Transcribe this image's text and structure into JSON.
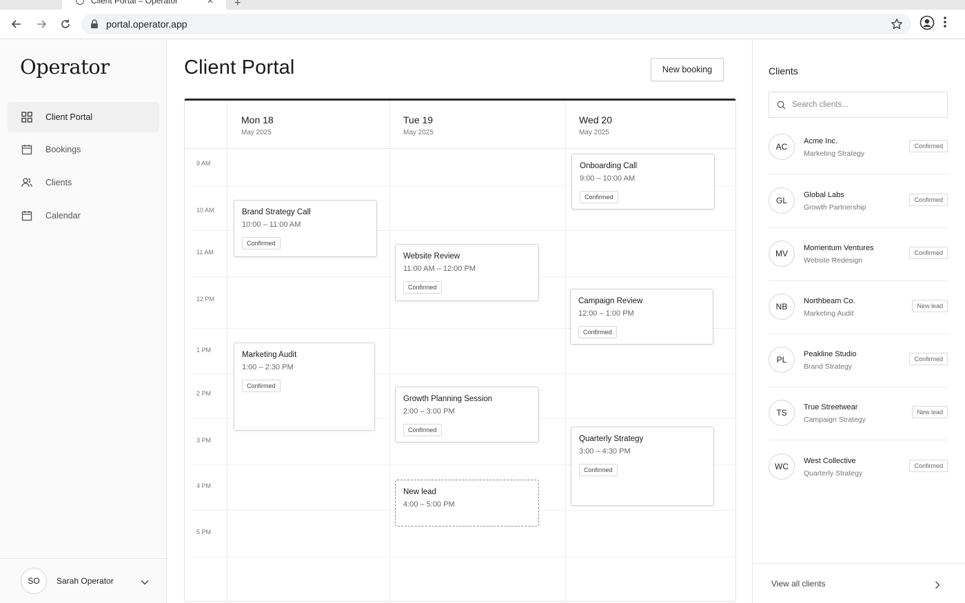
{
  "browser": {
    "tab_title": "Client Portal – Operator",
    "url": "portal.operator.app"
  },
  "sidebar": {
    "logo": "Operator",
    "items": [
      {
        "label": "Client Portal",
        "icon": "grid-icon",
        "active": true
      },
      {
        "label": "Bookings",
        "icon": "calendar-icon",
        "active": false
      },
      {
        "label": "Clients",
        "icon": "users-icon",
        "active": false
      },
      {
        "label": "Calendar",
        "icon": "calendar-icon",
        "active": false
      }
    ],
    "user": {
      "initials": "SO",
      "name": "Sarah Operator"
    }
  },
  "main": {
    "title": "Client Portal",
    "new_booking_label": "New booking",
    "days": [
      {
        "name": "Mon 18",
        "sub": "May 2025"
      },
      {
        "name": "Tue 19",
        "sub": "May 2025"
      },
      {
        "name": "Wed 20",
        "sub": "May 2025"
      }
    ],
    "time_labels": [
      "9 AM",
      "10 AM",
      "11 AM",
      "12 PM",
      "1 PM",
      "2 PM",
      "3 PM",
      "4 PM",
      "5 PM"
    ],
    "events": [
      {
        "day": 0,
        "title": "Brand Strategy Call",
        "time": "10:00 – 11:00 AM",
        "badge": "Confirmed",
        "dashed": false
      },
      {
        "day": 0,
        "title": "Marketing Audit",
        "time": "1:00 – 2:30 PM",
        "badge": "Confirmed",
        "dashed": false
      },
      {
        "day": 1,
        "title": "Website Review",
        "time": "11:00 AM – 12:00 PM",
        "badge": "Confirmed",
        "dashed": false
      },
      {
        "day": 1,
        "title": "Growth Planning Session",
        "time": "2:00 – 3:00 PM",
        "badge": "Confirmed",
        "dashed": false
      },
      {
        "day": 1,
        "title": "New lead",
        "time": "4:00 – 5:00 PM",
        "badge": "",
        "dashed": true
      },
      {
        "day": 2,
        "title": "Onboarding Call",
        "time": "9:00 – 10:00 AM",
        "badge": "Confirmed",
        "dashed": false
      },
      {
        "day": 2,
        "title": "Campaign Review",
        "time": "12:00 – 1:00 PM",
        "badge": "Confirmed",
        "dashed": false
      },
      {
        "day": 2,
        "title": "Quarterly Strategy",
        "time": "3:00 – 4:30 PM",
        "badge": "Confirmed",
        "dashed": false
      }
    ]
  },
  "clients_panel": {
    "title": "Clients",
    "search_placeholder": "Search clients...",
    "clients": [
      {
        "initials": "AC",
        "name": "Acme Inc.",
        "sub": "Marketing Strategy",
        "status": "Confirmed"
      },
      {
        "initials": "GL",
        "name": "Global Labs",
        "sub": "Growth Partnership",
        "status": "Confirmed"
      },
      {
        "initials": "MV",
        "name": "Momentum Ventures",
        "sub": "Website Redesign",
        "status": "Confirmed"
      },
      {
        "initials": "NB",
        "name": "Northbeam Co.",
        "sub": "Marketing Audit",
        "status": "New lead"
      },
      {
        "initials": "PL",
        "name": "Peakline Studio",
        "sub": "Brand Strategy",
        "status": "Confirmed"
      },
      {
        "initials": "TS",
        "name": "True Streetwear",
        "sub": "Campaign Strategy",
        "status": "New lead"
      },
      {
        "initials": "WC",
        "name": "West Collective",
        "sub": "Quarterly Strategy",
        "status": "Confirmed"
      }
    ],
    "view_all_label": "View all clients"
  }
}
